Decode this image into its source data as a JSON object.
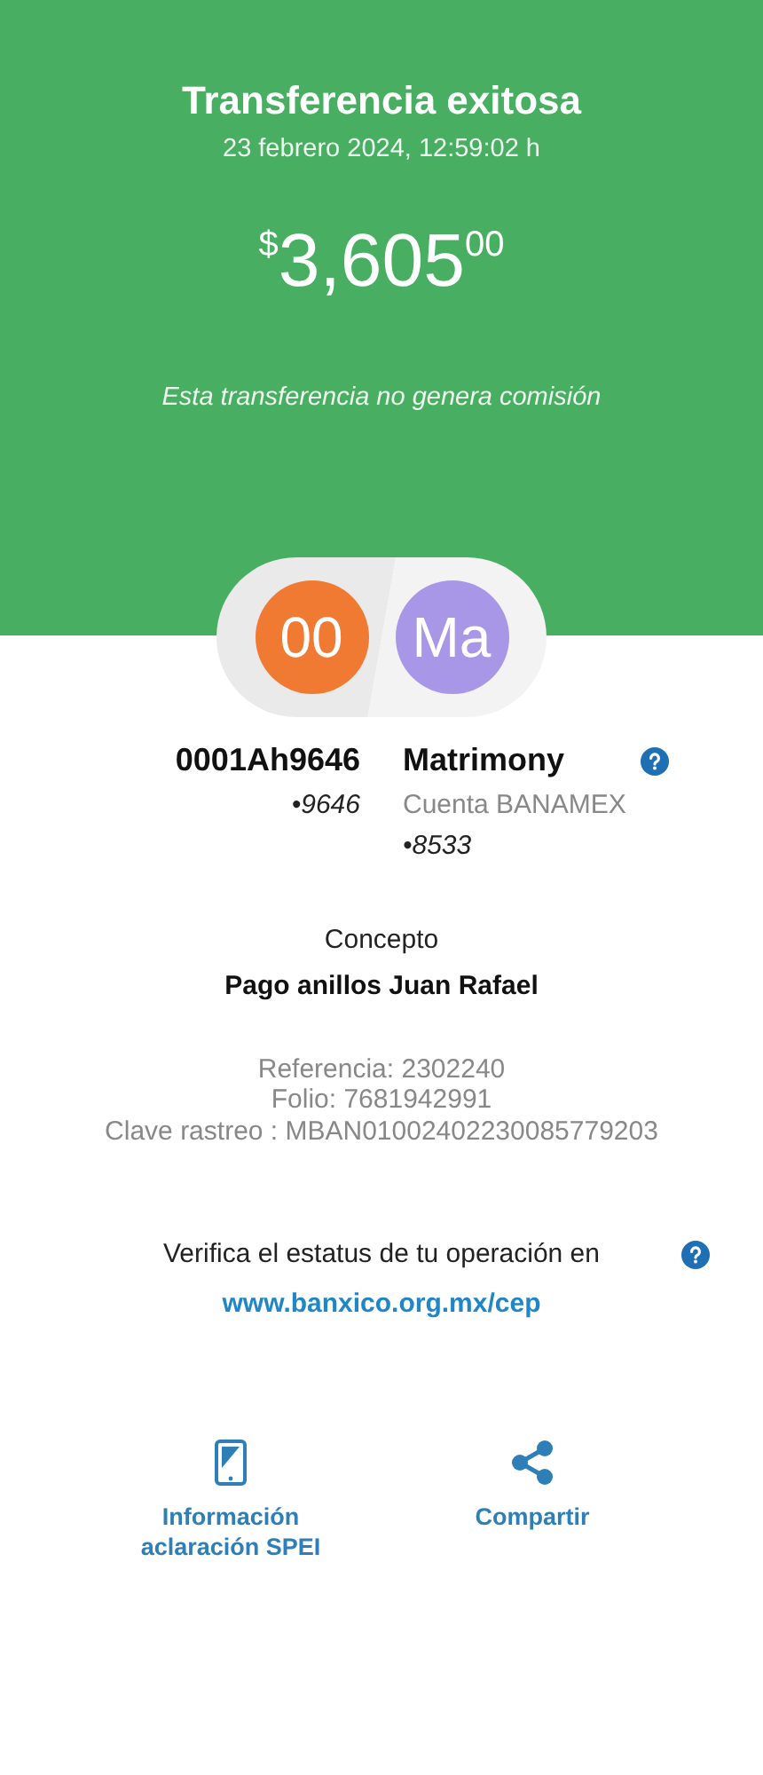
{
  "header": {
    "title": "Transferencia exitosa",
    "datetime": "23 febrero 2024, 12:59:02 h",
    "amount": {
      "currency": "$",
      "integer": "3,605",
      "cents": "00"
    },
    "note": "Esta transferencia no genera comisión"
  },
  "parties": [
    {
      "initials": "00",
      "color": "#f07a32",
      "name": "0001Ah9646",
      "account": "•9646"
    },
    {
      "initials": "Ma",
      "color": "#a896e6",
      "name": "Matrimony",
      "bank": "Cuenta BANAMEX",
      "account": "•8533",
      "help": true
    }
  ],
  "concept": {
    "label": "Concepto",
    "value": "Pago anillos Juan Rafael"
  },
  "details": [
    "Referencia: 2302240",
    "Folio: 7681942991",
    "Clave rastreo : MBAN01002402230085779203"
  ],
  "verify": {
    "text": "Verifica el estatus de tu operación en",
    "link": "www.banxico.org.mx/cep"
  },
  "actions": [
    {
      "kind": "phone",
      "label": "Información aclaración SPEI"
    },
    {
      "kind": "share",
      "label": "Compartir"
    }
  ]
}
